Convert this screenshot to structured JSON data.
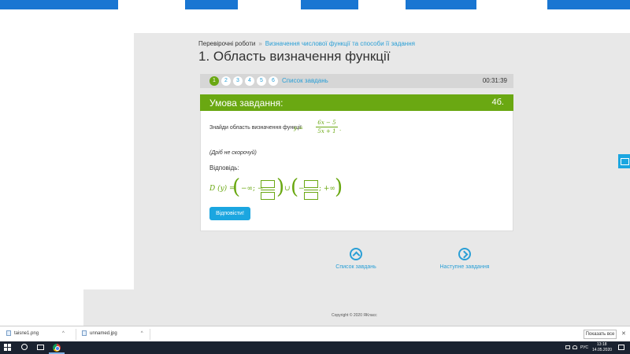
{
  "breadcrumb": {
    "root": "Перевірочні роботи",
    "separator": "»",
    "current": "Визначення числової функції та способи її задання"
  },
  "page_title": "1. Область визначення функції",
  "pager": {
    "numbers": [
      "1",
      "2",
      "3",
      "4",
      "5",
      "6"
    ],
    "active": "1",
    "list_link": "Список завдань",
    "timer": "00:31:39"
  },
  "task": {
    "header": "Умова завдання:",
    "points": "4б.",
    "question": "Знайди область визначення функції",
    "formula_lhs": "y =",
    "formula_num": "6x − 5",
    "formula_den": "5x + 1",
    "formula_end": ".",
    "note": "(Дріб не скорочуй)",
    "answer_label": "Відповідь:",
    "domain_lhs": "D (y) =",
    "neg_inf": "−∞; −",
    "union": "∪",
    "minus": "−",
    "pos_inf": "; +∞",
    "answer_button": "Відповісти!"
  },
  "nav": {
    "list": "Список завдань",
    "next": "Наступне завдання"
  },
  "copyright": "Copyright © 2020 ЯКласс",
  "downloads": {
    "items": [
      "taisne1.png",
      "unnamed.jpg"
    ],
    "show_all": "Показать все",
    "close": "✕"
  },
  "taskbar": {
    "lang": "РУС",
    "time": "13:18",
    "date": "14.05.2020"
  },
  "colors": {
    "accent_green": "#6aa812",
    "link_blue": "#2a9fd6",
    "button_blue": "#1ba6e0",
    "browser_blue": "#1976d2"
  }
}
